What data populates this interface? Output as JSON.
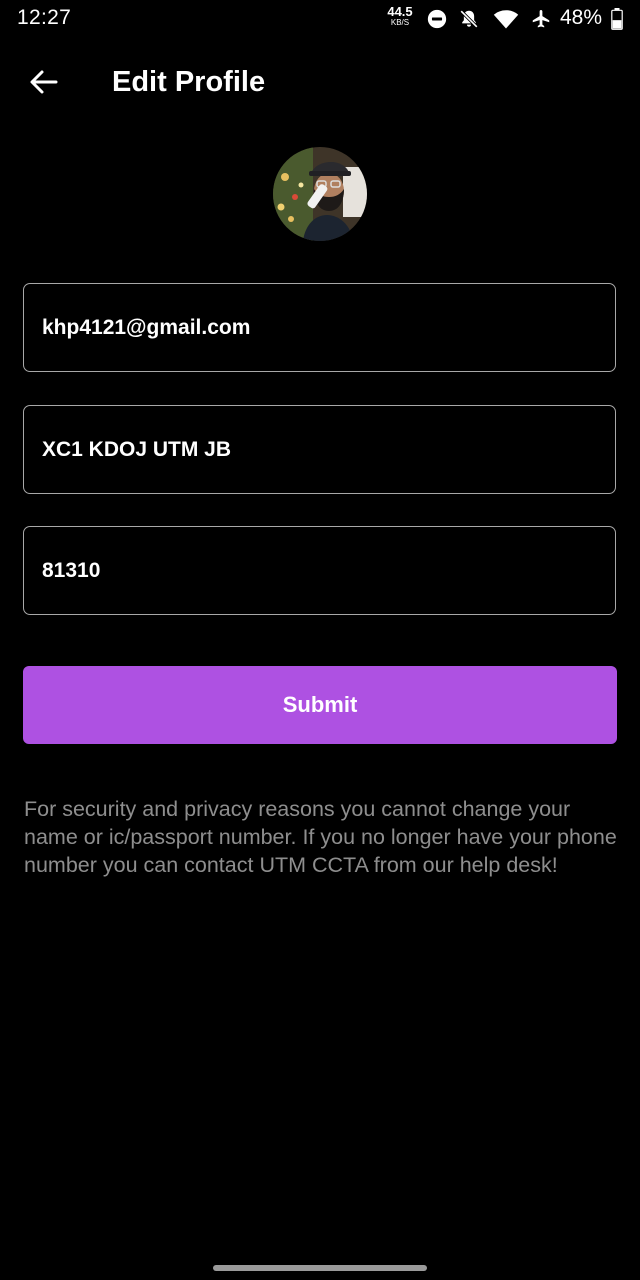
{
  "status_bar": {
    "time": "12:27",
    "net_speed_value": "44.5",
    "net_speed_unit": "KB/S",
    "battery_percent": "48%",
    "battery_level": 0.48,
    "icons": [
      "net-speed-indicator",
      "do-not-disturb-icon",
      "notifications-off-icon",
      "wifi-icon",
      "airplane-mode-icon",
      "battery-icon"
    ]
  },
  "header": {
    "back_icon": "arrow-left-icon",
    "title": "Edit Profile"
  },
  "form": {
    "email": {
      "value": "khp4121@gmail.com"
    },
    "address": {
      "value": "XC1 KDOJ UTM JB"
    },
    "postcode": {
      "value": "81310"
    },
    "submit_label": "Submit"
  },
  "notice": "For security and privacy reasons you cannot change your name or ic/passport number. If you no longer have your phone number you can contact UTM CCTA from our help desk!",
  "colors": {
    "background": "#000000",
    "accent": "#ae51e2",
    "field_border": "#a8a8a8",
    "muted_text": "#8e8e8e"
  }
}
